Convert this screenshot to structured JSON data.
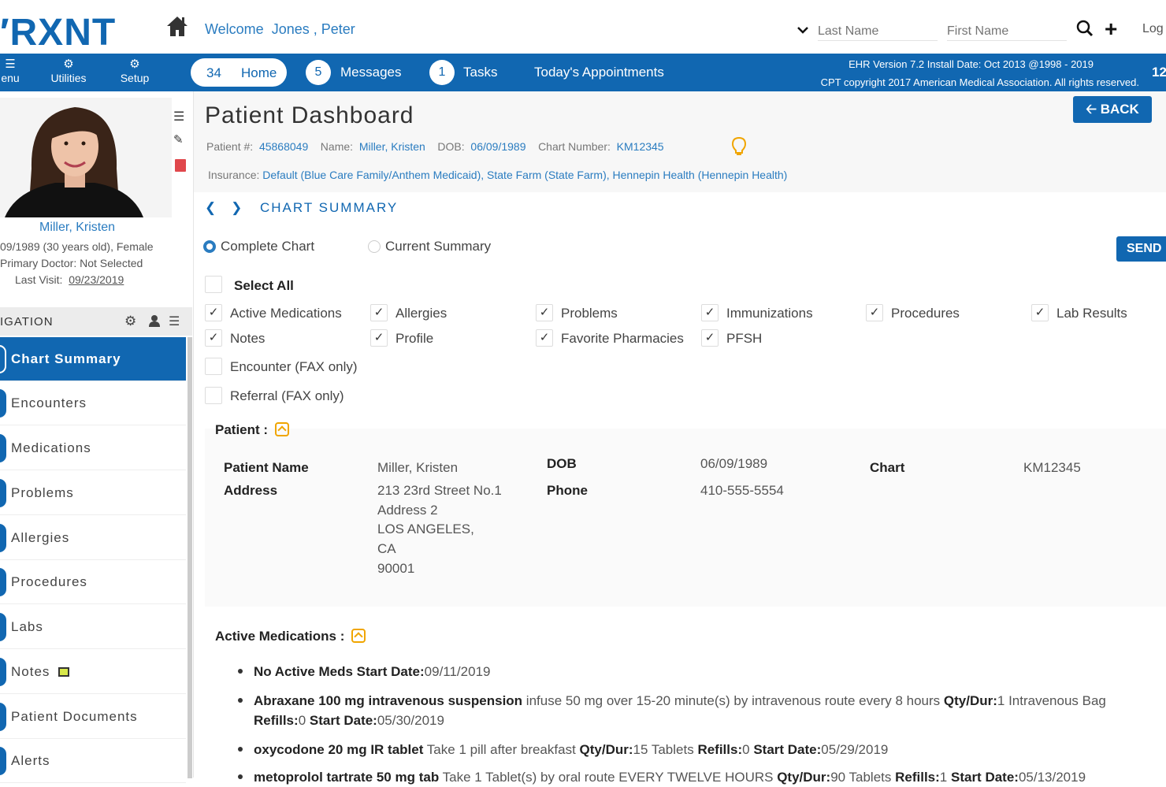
{
  "header": {
    "logo": "RXNT",
    "welcome_label": "Welcome",
    "welcome_name": "Jones , Peter",
    "search_last_placeholder": "Last Name",
    "search_first_placeholder": "First Name",
    "logout": "Log"
  },
  "nav": {
    "menu": "enu",
    "utilities": "Utilities",
    "setup": "Setup",
    "home_count": "34",
    "home_label": "Home",
    "messages_count": "5",
    "messages_label": "Messages",
    "tasks_count": "1",
    "tasks_label": "Tasks",
    "appointments": "Today's Appointments",
    "ehr_version": "EHR Version 7.2 Install Date: Oct 2013 @1998 - 2019",
    "cpt_copyright": "CPT copyright 2017 American Medical Association. All rights reserved.",
    "right_num": "12"
  },
  "sidebar": {
    "patient_name": "Miller, Kristen",
    "dob_line": "09/1989 (30 years old), Female",
    "primary_doctor": "Primary Doctor: Not Selected",
    "last_visit_label": "Last Visit:",
    "last_visit": "09/23/2019",
    "nav_header": "IGATION",
    "items": [
      {
        "label": "Chart Summary"
      },
      {
        "label": "Encounters"
      },
      {
        "label": "Medications"
      },
      {
        "label": "Problems"
      },
      {
        "label": "Allergies"
      },
      {
        "label": "Procedures"
      },
      {
        "label": "Labs"
      },
      {
        "label": "Notes"
      },
      {
        "label": "Patient Documents"
      },
      {
        "label": "Alerts"
      }
    ]
  },
  "dashboard": {
    "title": "Patient Dashboard",
    "back": "BACK",
    "patient_num_label": "Patient #:",
    "patient_num": "45868049",
    "name_label": "Name:",
    "name": "Miller, Kristen",
    "dob_label": "DOB:",
    "dob": "06/09/1989",
    "chart_label": "Chart Number:",
    "chart_number": "KM12345",
    "insurance_label": "Insurance:",
    "insurance": "Default (Blue Care Family/Anthem Medicaid), State Farm (State Farm), Hennepin Health (Hennepin Health)",
    "section": "CHART SUMMARY"
  },
  "summary": {
    "radio_complete": "Complete Chart",
    "radio_current": "Current Summary",
    "send": "SEND",
    "select_all": "Select All",
    "options": [
      {
        "label": "Active Medications",
        "checked": true
      },
      {
        "label": "Allergies",
        "checked": true
      },
      {
        "label": "Problems",
        "checked": true
      },
      {
        "label": "Immunizations",
        "checked": true
      },
      {
        "label": "Procedures",
        "checked": true
      },
      {
        "label": "Lab Results",
        "checked": true
      },
      {
        "label": "Notes",
        "checked": true
      },
      {
        "label": "Profile",
        "checked": true
      },
      {
        "label": "Favorite Pharmacies",
        "checked": true
      },
      {
        "label": "PFSH",
        "checked": true
      },
      {
        "label": "Encounter (FAX only)",
        "checked": false
      },
      {
        "label": "Referral (FAX only)",
        "checked": false
      }
    ]
  },
  "patient": {
    "heading": "Patient :",
    "name_label": "Patient Name",
    "name": "Miller, Kristen",
    "address_label": "Address",
    "address": [
      "213 23rd Street No.1",
      "Address 2",
      "LOS ANGELES,",
      "CA",
      "90001"
    ],
    "dob_label": "DOB",
    "dob": "06/09/1989",
    "phone_label": "Phone",
    "phone": "410-555-5554",
    "chart_label": "Chart",
    "chart": "KM12345"
  },
  "medications": {
    "heading": "Active Medications :",
    "m1_bold": "No Active Meds Start Date:",
    "m1_date": "09/11/2019",
    "m2_name": "Abraxane 100 mg intravenous suspension",
    "m2_sig": " infuse 50 mg over 15-20 minute(s) by intravenous route every 8 hours ",
    "m2_qty_label": "Qty/Dur:",
    "m2_qty": "1 Intravenous Bag",
    "m2_refills_label": "Refills:",
    "m2_refills": "0",
    "m2_start_label": " Start Date:",
    "m2_start": "05/30/2019",
    "m3_name": "oxycodone 20 mg IR tablet",
    "m3_sig": " Take 1 pill after breakfast ",
    "m3_qty_label": "Qty/Dur:",
    "m3_qty": "15 Tablets ",
    "m3_refills_label": "Refills:",
    "m3_refills": "0 ",
    "m3_start_label": "Start Date:",
    "m3_start": "05/29/2019",
    "m4_name": "metoprolol tartrate 50 mg tab",
    "m4_sig": " Take 1 Tablet(s) by oral route EVERY TWELVE HOURS ",
    "m4_qty_label": "Qty/Dur:",
    "m4_qty": "90 Tablets ",
    "m4_refills_label": "Refills:",
    "m4_refills": "1 ",
    "m4_start_label": "Start Date:",
    "m4_start": "05/13/2019"
  }
}
